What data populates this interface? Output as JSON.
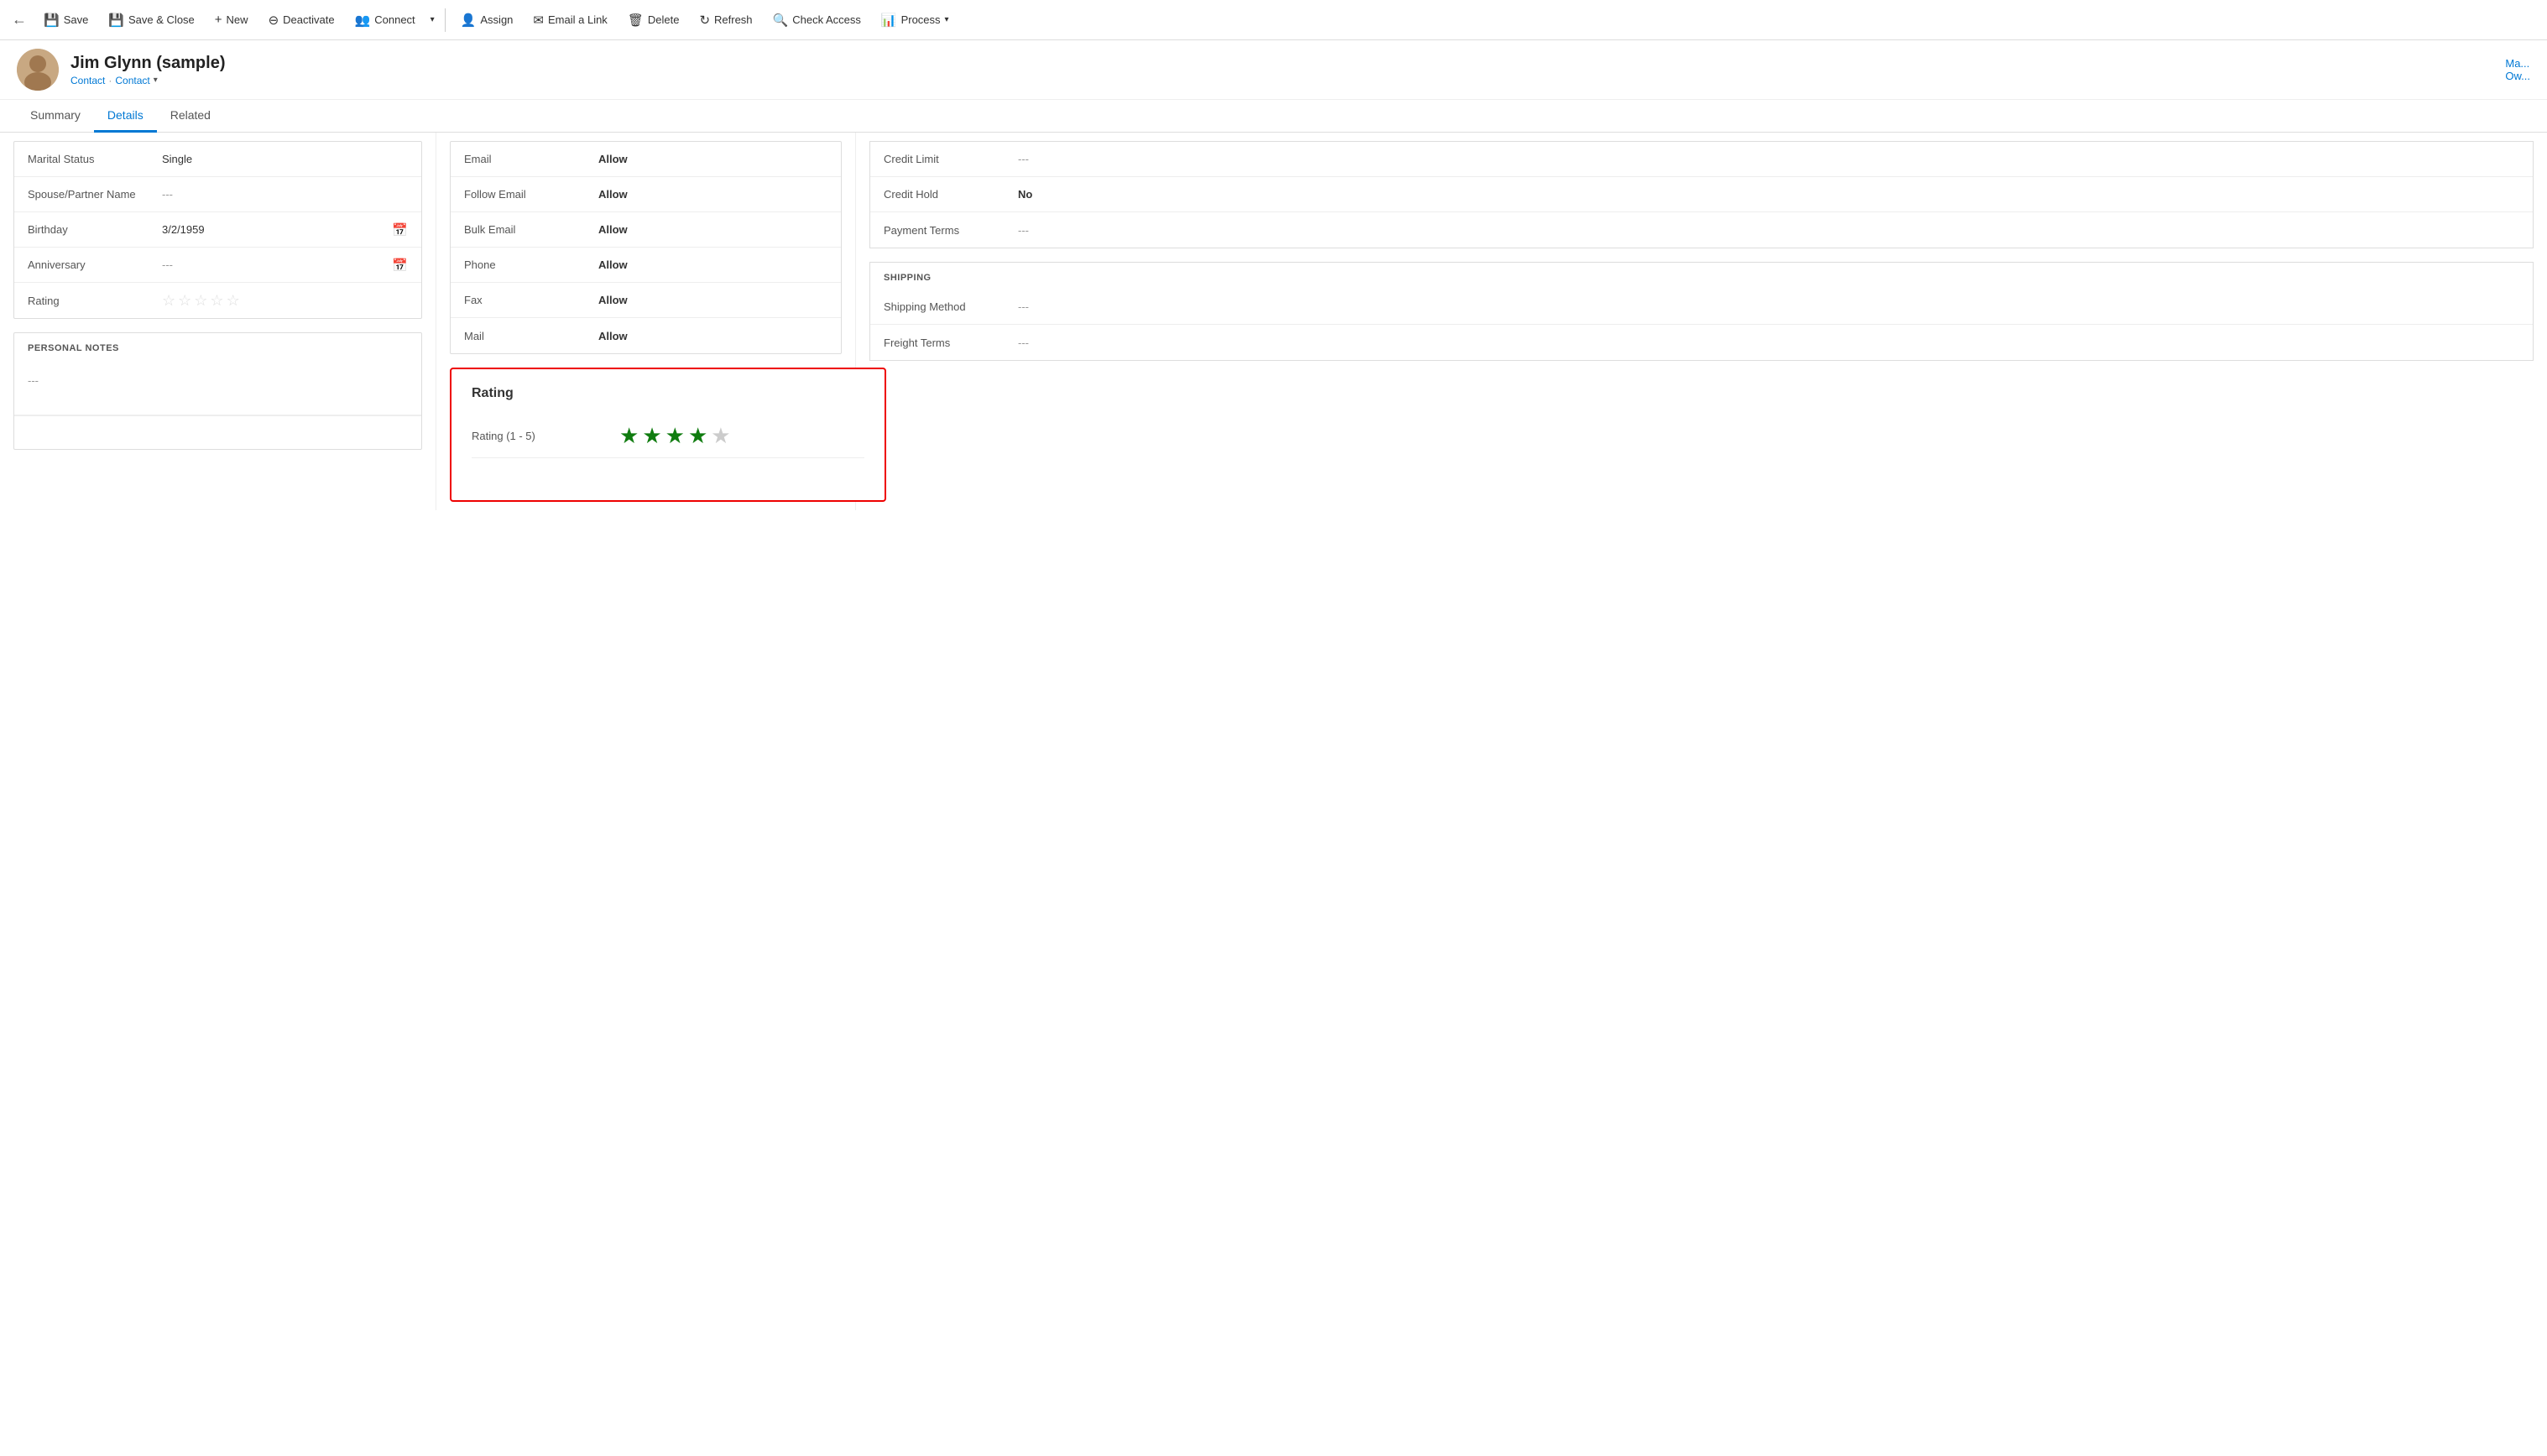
{
  "toolbar": {
    "back_icon": "←",
    "save_label": "Save",
    "save_icon": "💾",
    "save_close_label": "Save & Close",
    "save_close_icon": "💾",
    "new_label": "New",
    "new_icon": "+",
    "deactivate_label": "Deactivate",
    "deactivate_icon": "⊖",
    "connect_label": "Connect",
    "connect_icon": "👥",
    "chevron_icon": "▾",
    "assign_label": "Assign",
    "assign_icon": "👤",
    "email_link_label": "Email a Link",
    "email_link_icon": "✉",
    "delete_label": "Delete",
    "delete_icon": "🗑",
    "refresh_label": "Refresh",
    "refresh_icon": "↻",
    "check_access_label": "Check Access",
    "check_access_icon": "🔍",
    "process_label": "Process",
    "process_icon": "📊",
    "process_chevron": "▾"
  },
  "record": {
    "name": "Jim Glynn (sample)",
    "subtitle_type": "Contact",
    "subtitle_separator": "·",
    "subtitle_category": "Contact",
    "subtitle_chevron": "▾",
    "contact_right": "Ma...",
    "contact_right_sub": "Ow..."
  },
  "tabs": [
    {
      "label": "Summary",
      "active": false
    },
    {
      "label": "Details",
      "active": true
    },
    {
      "label": "Related",
      "active": false
    }
  ],
  "personal_section": {
    "fields": [
      {
        "label": "Marital Status",
        "value": "Single",
        "empty": false,
        "calendar": false,
        "bold": false
      },
      {
        "label": "Spouse/Partner Name",
        "value": "---",
        "empty": true,
        "calendar": false,
        "bold": false
      },
      {
        "label": "Birthday",
        "value": "3/2/1959",
        "empty": false,
        "calendar": true,
        "bold": false
      },
      {
        "label": "Anniversary",
        "value": "---",
        "empty": true,
        "calendar": true,
        "bold": false
      },
      {
        "label": "Rating",
        "value": "",
        "empty": false,
        "calendar": false,
        "stars": true,
        "bold": false
      }
    ]
  },
  "personal_notes": {
    "title": "PERSONAL NOTES",
    "value": "---"
  },
  "contact_preferences": {
    "fields": [
      {
        "label": "Email",
        "value": "Allow",
        "empty": false,
        "bold": true
      },
      {
        "label": "Follow Email",
        "value": "Allow",
        "empty": false,
        "bold": true
      },
      {
        "label": "Bulk Email",
        "value": "Allow",
        "empty": false,
        "bold": true
      },
      {
        "label": "Phone",
        "value": "Allow",
        "empty": false,
        "bold": true
      },
      {
        "label": "Fax",
        "value": "Allow",
        "empty": false,
        "bold": true
      },
      {
        "label": "Mail",
        "value": "Allow",
        "empty": false,
        "bold": true
      }
    ]
  },
  "rating_popup": {
    "title": "Rating",
    "label": "Rating (1 - 5)",
    "filled_stars": 4,
    "total_stars": 5
  },
  "billing": {
    "fields": [
      {
        "label": "Credit Limit",
        "value": "---",
        "empty": true,
        "bold": false
      },
      {
        "label": "Credit Hold",
        "value": "No",
        "empty": false,
        "bold": true
      },
      {
        "label": "Payment Terms",
        "value": "---",
        "empty": true,
        "bold": false
      }
    ]
  },
  "shipping": {
    "title": "SHIPPING",
    "fields": [
      {
        "label": "Shipping Method",
        "value": "---",
        "empty": true,
        "bold": false
      },
      {
        "label": "Freight Terms",
        "value": "---",
        "empty": true,
        "bold": false
      }
    ]
  }
}
